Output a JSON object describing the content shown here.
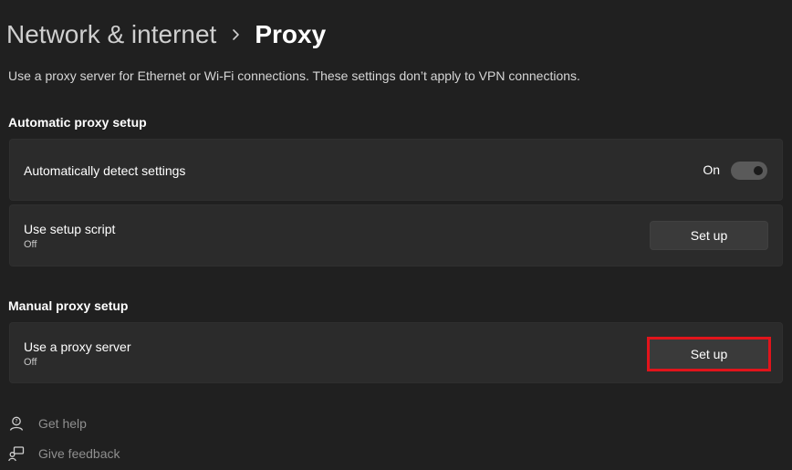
{
  "breadcrumb": {
    "parent": "Network & internet",
    "current": "Proxy"
  },
  "description": "Use a proxy server for Ethernet or Wi-Fi connections. These settings don’t apply to VPN connections.",
  "automatic": {
    "section_title": "Automatic proxy setup",
    "detect": {
      "label": "Automatically detect settings",
      "state_label": "On",
      "enabled": true
    },
    "script": {
      "label": "Use setup script",
      "status": "Off",
      "button_label": "Set up"
    }
  },
  "manual": {
    "section_title": "Manual proxy setup",
    "proxy_server": {
      "label": "Use a proxy server",
      "status": "Off",
      "button_label": "Set up"
    }
  },
  "footer": {
    "help_label": "Get help",
    "feedback_label": "Give feedback"
  },
  "colors": {
    "background": "#202020",
    "card": "#2b2b2b",
    "highlight_border": "#e1141b",
    "toggle_on": "#5a5a5a"
  },
  "icons": {
    "separator": "chevron-right-icon",
    "help": "help-person-icon",
    "feedback": "feedback-icon"
  }
}
